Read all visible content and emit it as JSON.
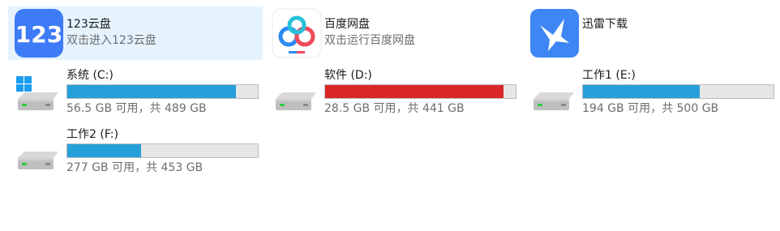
{
  "apps": [
    {
      "title": "123云盘",
      "subtitle": "双击进入123云盘",
      "icon": "app-123pan-icon",
      "selected": true
    },
    {
      "title": "百度网盘",
      "subtitle": "双击运行百度网盘",
      "icon": "baidu-netdisk-icon",
      "selected": false
    },
    {
      "title": "迅雷下载",
      "subtitle": "",
      "icon": "xunlei-bird-icon",
      "selected": false
    }
  ],
  "drives": [
    {
      "name": "系统 (C:)",
      "usage": "56.5 GB 可用，共 489 GB",
      "used_fraction": 0.884,
      "color": "#26a0da",
      "icon": "windows-drive-icon"
    },
    {
      "name": "软件 (D:)",
      "usage": "28.5 GB 可用，共 441 GB",
      "used_fraction": 0.935,
      "color": "#da2626",
      "icon": "hard-drive-icon"
    },
    {
      "name": "工作1 (E:)",
      "usage": "194 GB 可用，共 500 GB",
      "used_fraction": 0.612,
      "color": "#26a0da",
      "icon": "hard-drive-icon"
    },
    {
      "name": "工作2 (F:)",
      "usage": "277 GB 可用，共 453 GB",
      "used_fraction": 0.389,
      "color": "#26a0da",
      "icon": "hard-drive-icon"
    }
  ],
  "colors": {
    "selection_bg": "#e5f3ff",
    "bar_normal": "#26a0da",
    "bar_full": "#da2626",
    "bar_track": "#e6e6e6"
  }
}
